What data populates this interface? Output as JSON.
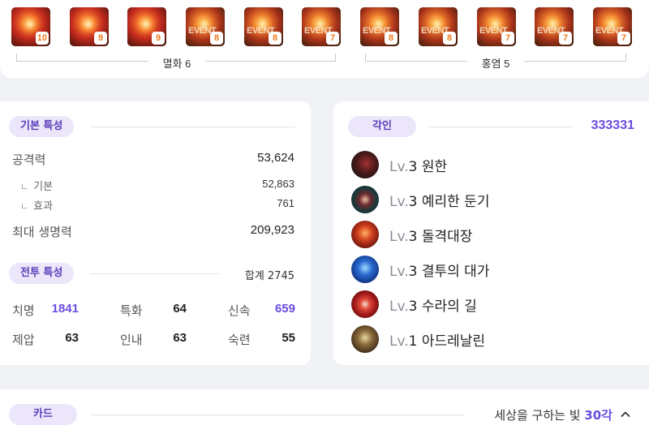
{
  "gems": [
    {
      "level": "10",
      "event": false,
      "tone": "red"
    },
    {
      "level": "9",
      "event": false,
      "tone": "red"
    },
    {
      "level": "9",
      "event": false,
      "tone": "red"
    },
    {
      "level": "8",
      "event": true,
      "tone": "orange"
    },
    {
      "level": "8",
      "event": true,
      "tone": "orange"
    },
    {
      "level": "7",
      "event": true,
      "tone": "orange"
    },
    {
      "level": "8",
      "event": true,
      "tone": "orange"
    },
    {
      "level": "8",
      "event": true,
      "tone": "orange"
    },
    {
      "level": "7",
      "event": true,
      "tone": "orange"
    },
    {
      "level": "7",
      "event": true,
      "tone": "orange"
    },
    {
      "level": "7",
      "event": true,
      "tone": "orange"
    }
  ],
  "event_overlay": "EVENT",
  "gem_groups": {
    "left_label": "멸화 6",
    "right_label": "홍염 5"
  },
  "basic_stats": {
    "title": "기본 특성",
    "attack_label": "공격력",
    "attack_value": "53,624",
    "base_label": "기본",
    "base_value": "52,863",
    "effect_label": "효과",
    "effect_value": "761",
    "hp_label": "최대 생명력",
    "hp_value": "209,923",
    "sub_marker": "ㄴ"
  },
  "combat_stats": {
    "title": "전투 특성",
    "total_label": "합계 2745",
    "crit_label": "치명",
    "crit_value": "1841",
    "spec_label": "특화",
    "spec_value": "64",
    "swift_label": "신속",
    "swift_value": "659",
    "dom_label": "제압",
    "dom_value": "63",
    "end_label": "인내",
    "end_value": "63",
    "exp_label": "숙련",
    "exp_value": "55"
  },
  "engravings": {
    "title": "각인",
    "total": "333331",
    "items": [
      {
        "lv": "Lv.",
        "num": "3",
        "name": "원한"
      },
      {
        "lv": "Lv.",
        "num": "3",
        "name": "예리한 둔기"
      },
      {
        "lv": "Lv.",
        "num": "3",
        "name": "돌격대장"
      },
      {
        "lv": "Lv.",
        "num": "3",
        "name": "결투의 대가"
      },
      {
        "lv": "Lv.",
        "num": "3",
        "name": "수라의 길"
      },
      {
        "lv": "Lv.",
        "num": "1",
        "name": "아드레날린"
      }
    ]
  },
  "cards": {
    "title": "카드",
    "set_name": "세상을 구하는 빛",
    "awaken": "30각"
  },
  "colors": {
    "accent": "#6a4de0",
    "pill_bg": "#ece6fb",
    "level_badge_text": "#f07a1e"
  }
}
